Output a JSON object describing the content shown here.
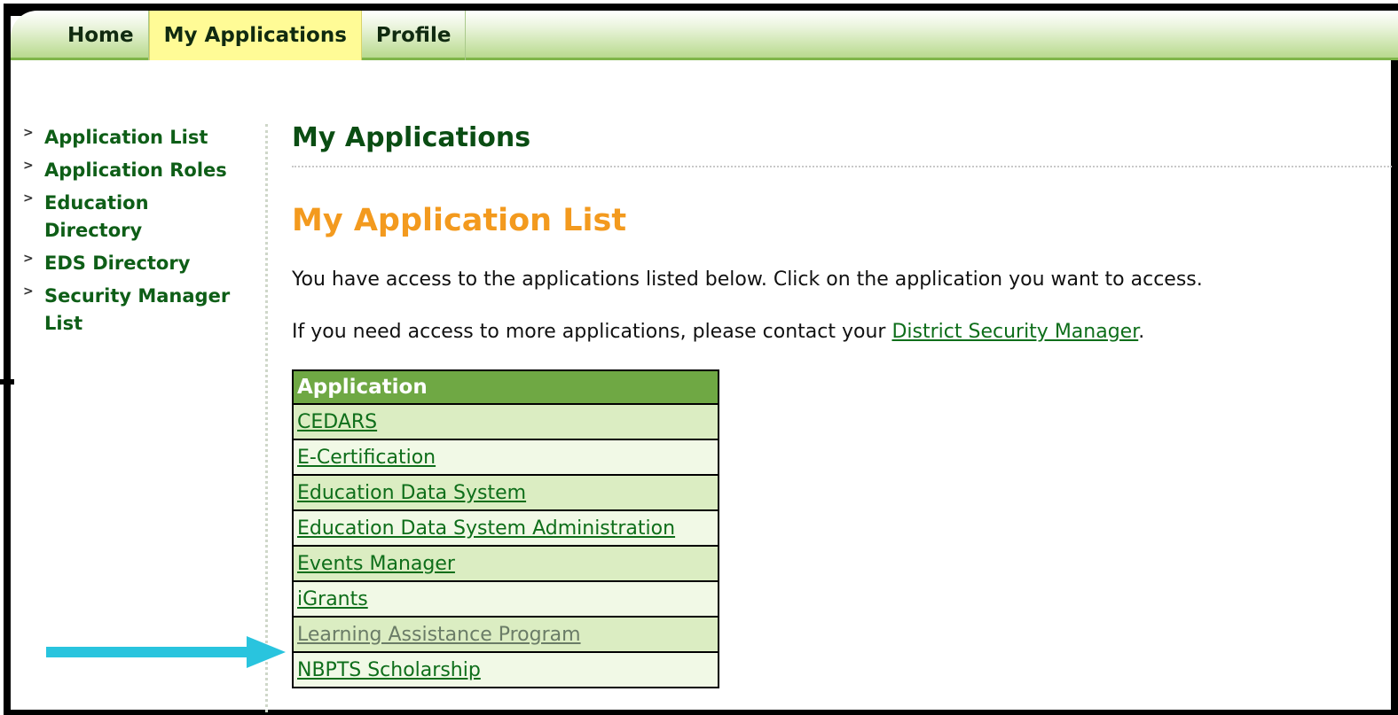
{
  "nav": {
    "tabs": [
      {
        "label": "Home",
        "active": false
      },
      {
        "label": "My Applications",
        "active": true
      },
      {
        "label": "Profile",
        "active": false
      }
    ]
  },
  "sidebar": {
    "items": [
      {
        "label": "Application List"
      },
      {
        "label": "Application Roles"
      },
      {
        "label": "Education Directory"
      },
      {
        "label": "EDS Directory"
      },
      {
        "label": "Security Manager List"
      }
    ]
  },
  "main": {
    "title": "My Applications",
    "subtitle": "My Application List",
    "intro": "You have access to the applications listed below. Click on the application you want to access.",
    "contact_prefix": "If you need access to more applications, please contact your ",
    "contact_link": "District Security Manager",
    "contact_suffix": "."
  },
  "table": {
    "header": "Application",
    "rows": [
      "CEDARS",
      "E-Certification",
      "Education Data System",
      "Education Data System Administration",
      "Events Manager",
      "iGrants",
      "Learning Assistance Program",
      "NBPTS Scholarship"
    ]
  },
  "annotation": {
    "arrow_color": "#29c4de",
    "points_to": "Learning Assistance Program"
  }
}
